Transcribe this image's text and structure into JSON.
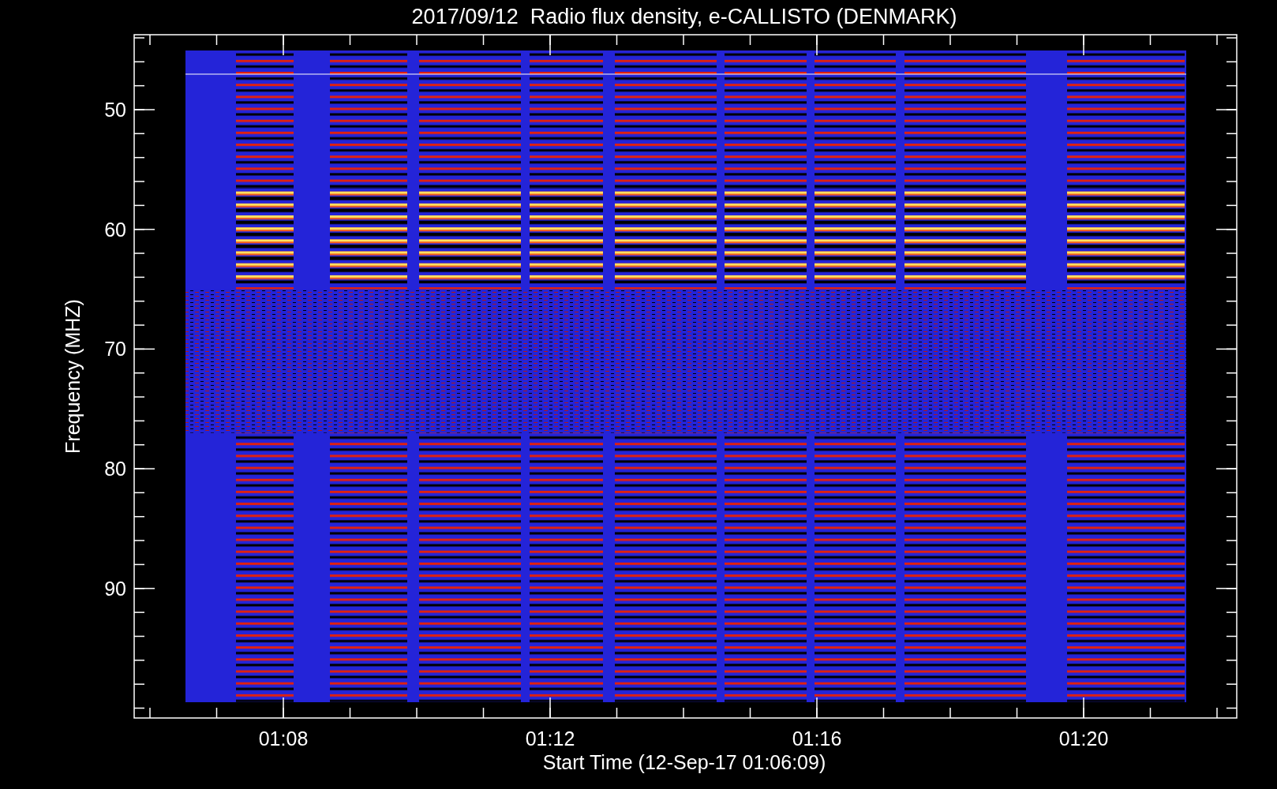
{
  "title": "2017/09/12  Radio flux density, e-CALLISTO (DENMARK)",
  "y_axis": {
    "label": "Frequency (MHZ)",
    "ticks": [
      "50",
      "60",
      "70",
      "80",
      "90"
    ]
  },
  "x_axis": {
    "label": "Start Time (12-Sep-17 01:06:09)",
    "ticks": [
      "01:08",
      "01:12",
      "01:16",
      "01:20"
    ]
  }
}
